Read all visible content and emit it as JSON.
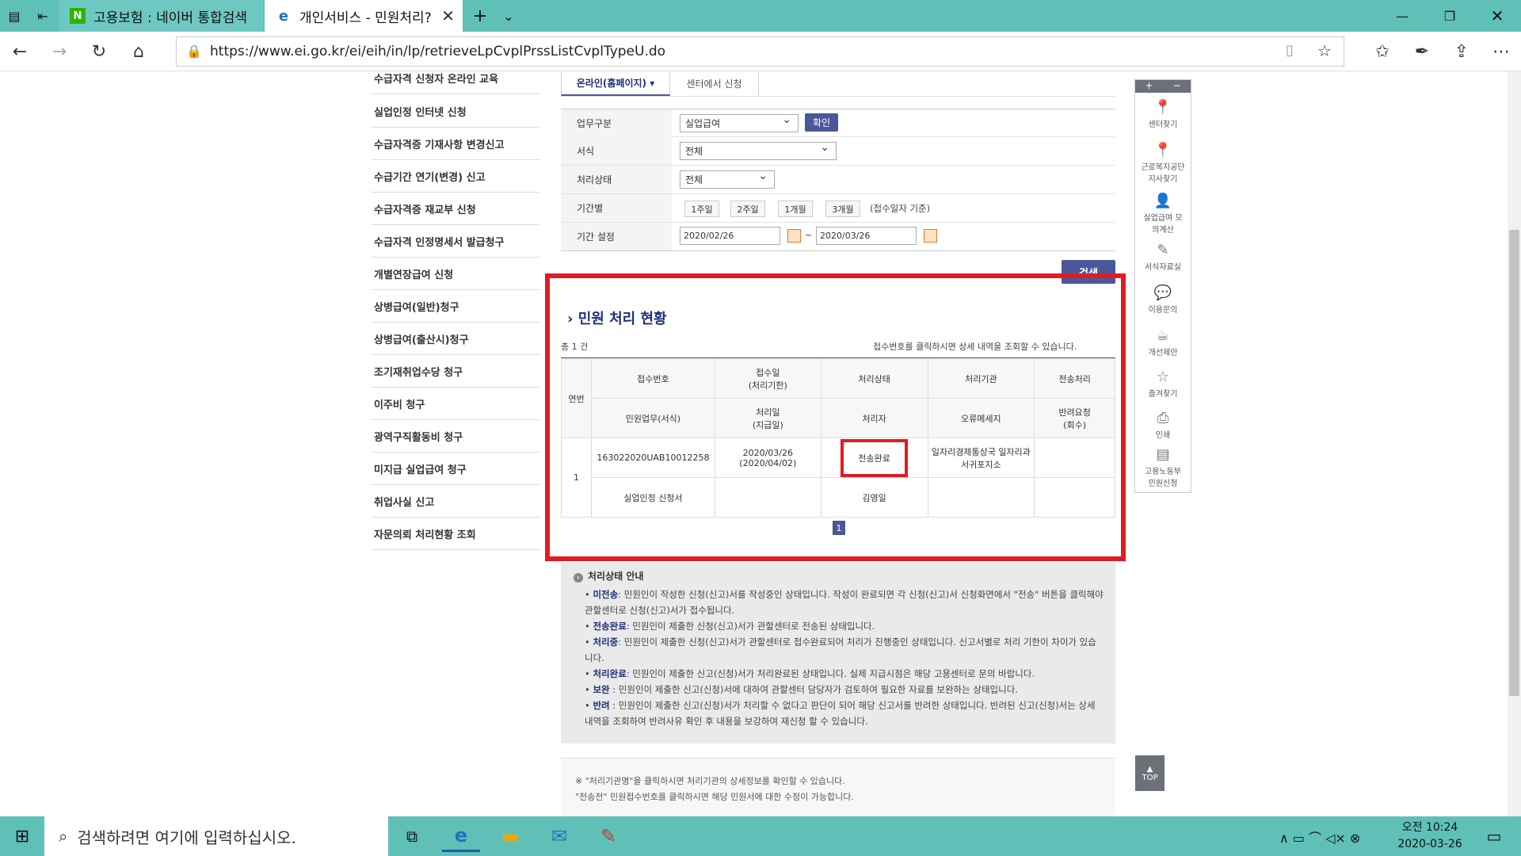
{
  "browser": {
    "tabs": [
      {
        "title": "고용보험 : 네이버 통합검색",
        "icon": "N"
      },
      {
        "title": "개인서비스 - 민원처리?",
        "icon": "e"
      }
    ],
    "url": "https://www.ei.go.kr/ei/eih/in/lp/retrieveLpCvplPrssListCvplTypeU.do"
  },
  "left_menu": [
    "수급자격 신청자 온라인 교육",
    "실업인정 인터넷 신청",
    "수급자격증 기재사항 변경신고",
    "수급기간 연기(변경) 신고",
    "수급자격증 재교부 신청",
    "수급자격 인정명세서 발급청구",
    "개별연장급여 신청",
    "상병급여(일반)청구",
    "상병급여(출산시)청구",
    "조기재취업수당 청구",
    "이주비 청구",
    "광역구직활동비 청구",
    "미지급 실업급여 청구",
    "취업사실 신고",
    "자문의뢰 처리현황 조회"
  ],
  "tabs": {
    "online": "온라인(홈페이지) ▾",
    "center": "센터에서 신청"
  },
  "form": {
    "work_label": "업무구분",
    "work_value": "실업급여",
    "confirm": "확인",
    "form_label": "서식",
    "form_value": "전체",
    "status_label": "처리상태",
    "status_value": "전체",
    "period_label": "기간별",
    "p1": "1주일",
    "p2": "2주일",
    "p3": "1개월",
    "p4": "3개월",
    "period_note": "(접수일자 기준)",
    "range_label": "기간 설정",
    "date_from": "2020/02/26",
    "tilde": "~",
    "date_to": "2020/03/26",
    "search": "검색"
  },
  "results": {
    "title": "민원 처리 현황",
    "total": "총 1 건",
    "hint": "접수번호를 클릭하시면 상세 내역을 조회할 수 있습니다.",
    "headers": {
      "no": "연번",
      "receipt": "접수번호",
      "recv_date": "접수일",
      "recv_date2": "(처리기한)",
      "status": "처리상태",
      "agency": "처리기관",
      "send": "전송처리",
      "service": "민원업무(서식)",
      "proc_date": "처리일",
      "proc_date2": "(지급일)",
      "handler": "처리자",
      "error": "오류메세지",
      "return": "반려요청",
      "return2": "(회수)"
    },
    "row": {
      "no": "1",
      "receipt": "163022020UAB10012258",
      "recv_date": "2020/03/26",
      "due": "(2020/04/02)",
      "status": "전송완료",
      "agency": "일자리경제통상국 일자리과 서귀포지소",
      "service": "실업인정 신청서",
      "handler": "김영일"
    },
    "page": "1"
  },
  "guide": {
    "title": "처리상태 안내",
    "items": [
      {
        "k": "미전송",
        "t": ": 민원인이 작성한 신청(신고)서를 작성중인 상태입니다. 작성이 완료되면 각 신청(신고)서 신청화면에서 \"전송\" 버튼을 클릭해야 관할센터로 신청(신고)서가 접수됩니다."
      },
      {
        "k": "전송완료",
        "t": ": 민원인이 제출한 신청(신고)서가 관할센터로 전송된 상태입니다."
      },
      {
        "k": "처리중",
        "t": ": 민원인이 제출한 신청(신고)서가 관할센터로 접수완료되어 처리가 진행중인 상태입니다. 신고서별로 처리 기한이 차이가 있습니다."
      },
      {
        "k": "처리완료",
        "t": ": 민원인이 제출한 신고(신청)서가 처리완료된 상태입니다. 실제 지급시점은 해당 고용센터로 문의 바랍니다."
      },
      {
        "k": "보완",
        "t": " : 민원인이 제출한 신고(신청)서에 대하여 관할센터 담당자가 검토하여 필요한 자료를 보완하는 상태입니다."
      },
      {
        "k": "반려",
        "t": " : 민원인이 제출한 신고(신청)서가 처리할 수 없다고 판단이 되어 해당 신고서를 반려한 상태입니다. 반려된 신고(신청)서는 상세내역을 조회하여 반려사유 확인 후 내용을 보강하여 재신청 할 수 있습니다."
      }
    ]
  },
  "notes": [
    "※ \"처리기관명\"을 클릭하시면 처리기관의 상세정보를 확인할 수 있습니다.",
    "\"전송전\" 민원접수번호를 클릭하시면 해당 민원서에 대한 수정이 가능합니다."
  ],
  "quick_menu": {
    "plus": "+",
    "minus": "−",
    "items": [
      {
        "icon": "📍",
        "label": "센터찾기"
      },
      {
        "icon": "📍",
        "label": "근로복지공단 지사찾기"
      },
      {
        "icon": "👤",
        "label": "실업급여 모의계산"
      },
      {
        "icon": "✎",
        "label": "서식자료실"
      },
      {
        "icon": "💬",
        "label": "이용문의"
      },
      {
        "icon": "☕",
        "label": "개선제안"
      },
      {
        "icon": "☆",
        "label": "즐겨찾기"
      },
      {
        "icon": "⎙",
        "label": "인쇄"
      },
      {
        "icon": "▤",
        "label": "고용노동부 민원신청"
      }
    ],
    "top": "TOP"
  },
  "taskbar": {
    "search_placeholder": "검색하려면 여기에 입력하십시오.",
    "time": "오전 10:24",
    "date": "2020-03-26"
  },
  "colors": {
    "accent": "#5fc0b8",
    "highlight": "#e21b23",
    "brand": "#1e2f7a"
  }
}
